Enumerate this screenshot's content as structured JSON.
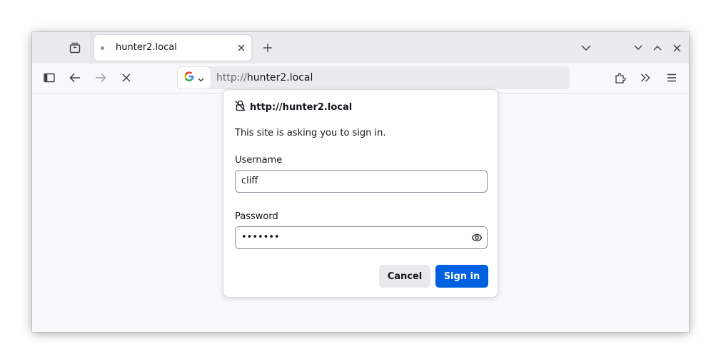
{
  "tab": {
    "title": "hunter2.local"
  },
  "urlbar": {
    "scheme": "http://",
    "host": "hunter2.local",
    "search_engine_icon": "google-g-icon"
  },
  "toolbar": {
    "icons": [
      "sidebar-icon",
      "back-arrow-icon",
      "forward-arrow-icon",
      "stop-icon",
      "extensions-icon",
      "overflow-chevrons-icon",
      "hamburger-menu-icon"
    ]
  },
  "titlebar": {
    "icons": [
      "firefox-view-icon",
      "new-tab-plus-icon",
      "list-all-tabs-icon",
      "minimize-icon",
      "maximize-icon",
      "close-window-icon"
    ]
  },
  "auth_dialog": {
    "origin": "http://hunter2.local",
    "message": "This site is asking you to sign in.",
    "username_label": "Username",
    "username_value": "cliff",
    "password_label": "Password",
    "password_value": "•••••••",
    "cancel_label": "Cancel",
    "signin_label": "Sign in"
  },
  "colors": {
    "primary_button": "#0061e0",
    "secondary_button": "#e9e9ed",
    "tabbar_bg": "#ebebef",
    "content_bg": "#f9f9fb"
  }
}
